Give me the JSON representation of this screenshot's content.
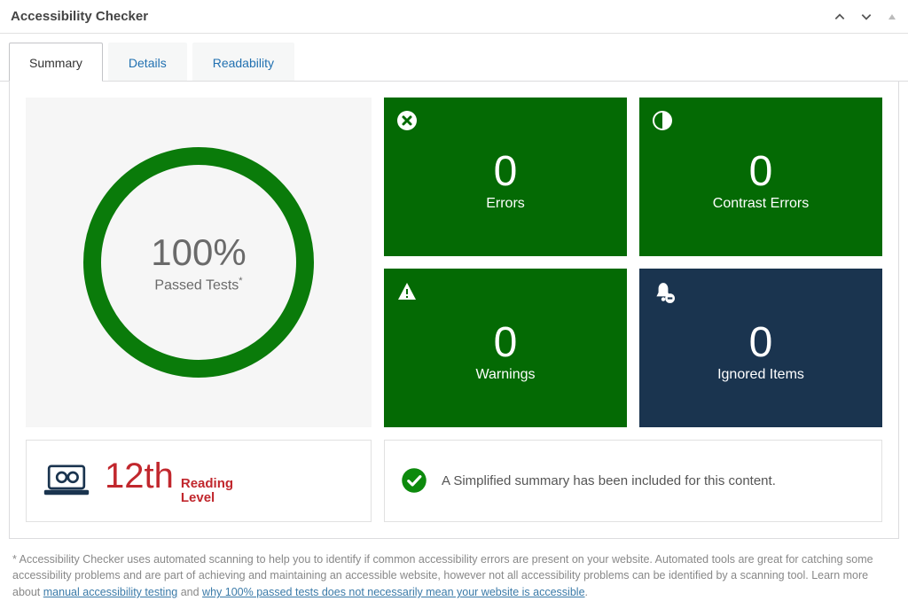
{
  "header": {
    "title": "Accessibility Checker"
  },
  "tabs": [
    {
      "id": "summary",
      "label": "Summary",
      "active": true
    },
    {
      "id": "details",
      "label": "Details",
      "active": false
    },
    {
      "id": "readability",
      "label": "Readability",
      "active": false
    }
  ],
  "summary": {
    "passed_pct": "100%",
    "passed_label": "Passed Tests",
    "tiles": {
      "errors": {
        "count": "0",
        "label": "Errors"
      },
      "contrast": {
        "count": "0",
        "label": "Contrast Errors"
      },
      "warnings": {
        "count": "0",
        "label": "Warnings"
      },
      "ignored": {
        "count": "0",
        "label": "Ignored Items"
      }
    }
  },
  "reading": {
    "grade": "12th",
    "label_line1": "Reading",
    "label_line2": "Level"
  },
  "simplified": {
    "text": "A Simplified summary has been included for this content."
  },
  "footnote": {
    "text_before": "* Accessibility Checker uses automated scanning to help you to identify if common accessibility errors are present on your website. Automated tools are great for catching some accessibility problems and are part of achieving and maintaining an accessible website, however not all accessibility problems can be identified by a scanning tool. Learn more about ",
    "link1": "manual accessibility testing",
    "between": " and ",
    "link2": "why 100% passed tests does not necessarily mean your website is accessible",
    "after": "."
  }
}
